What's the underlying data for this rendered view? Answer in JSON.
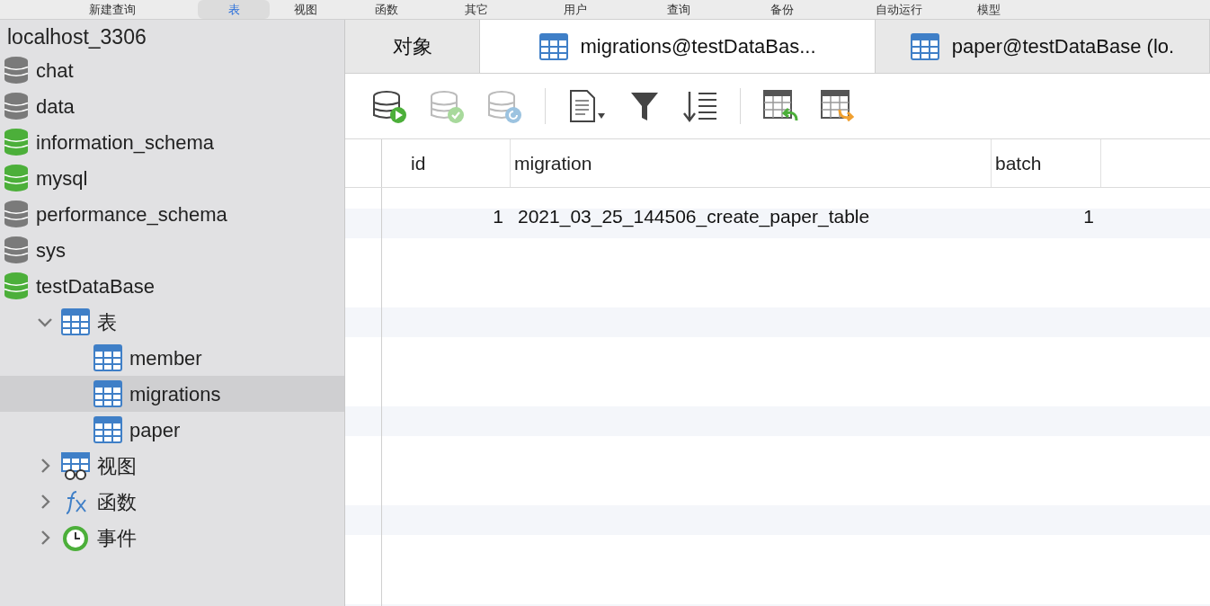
{
  "top_toolbar": [
    {
      "label": "新建查询",
      "selected": false
    },
    {
      "label": "表",
      "selected": true
    },
    {
      "label": "视图",
      "selected": false
    },
    {
      "label": "函数",
      "selected": false
    },
    {
      "label": "其它",
      "selected": false
    },
    {
      "label": "用户",
      "selected": false
    },
    {
      "label": "查询",
      "selected": false
    },
    {
      "label": "备份",
      "selected": false
    },
    {
      "label": "自动运行",
      "selected": false
    },
    {
      "label": "模型",
      "selected": false
    }
  ],
  "sidebar": {
    "connection": "localhost_3306",
    "items": [
      {
        "label": "chat",
        "kind": "database",
        "open": false
      },
      {
        "label": "data",
        "kind": "database",
        "open": false
      },
      {
        "label": "information_schema",
        "kind": "database",
        "open": true
      },
      {
        "label": "mysql",
        "kind": "database",
        "open": true
      },
      {
        "label": "performance_schema",
        "kind": "database",
        "open": false
      },
      {
        "label": "sys",
        "kind": "database",
        "open": false
      },
      {
        "label": "testDataBase",
        "kind": "database",
        "open": true,
        "children": [
          {
            "label": "表",
            "kind": "tables",
            "expanded": true,
            "children": [
              {
                "label": "member",
                "kind": "table",
                "selected": false
              },
              {
                "label": "migrations",
                "kind": "table",
                "selected": true
              },
              {
                "label": "paper",
                "kind": "table",
                "selected": false
              }
            ]
          },
          {
            "label": "视图",
            "kind": "views",
            "expanded": false
          },
          {
            "label": "函数",
            "kind": "functions",
            "expanded": false
          },
          {
            "label": "事件",
            "kind": "events",
            "expanded": false
          }
        ]
      }
    ]
  },
  "tabs": [
    {
      "label": "对象",
      "kind": "objects",
      "selected": false
    },
    {
      "label": "migrations@testDataBas...",
      "kind": "table",
      "selected": true
    },
    {
      "label": "paper@testDataBase (lo.",
      "kind": "table",
      "selected": false
    }
  ],
  "table": {
    "columns": [
      "id",
      "migration",
      "batch"
    ],
    "rows": [
      [
        "1",
        "2021_03_25_144506_create_paper_table",
        "1"
      ]
    ]
  }
}
